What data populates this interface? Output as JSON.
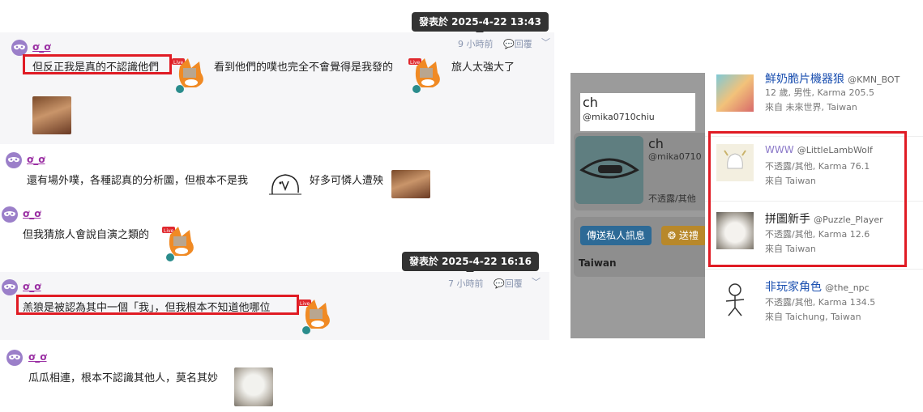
{
  "thread1": {
    "tooltip": "發表於 2025-4-22 13:43",
    "time": "9 小時前",
    "reply": "回覆",
    "username": "ơ_ơ",
    "segments": [
      "但反正我是真的不認識他們",
      "看到他們的噗也完全不會覺得是我發的",
      "旅人太強大了"
    ]
  },
  "msg2": {
    "username": "ơ_ơ",
    "segments": [
      "還有場外噗，各種認真的分析圖，但根本不是我",
      "好多可憐人遭殃"
    ]
  },
  "msg3": {
    "username": "ơ_ơ",
    "text": "但我猜旅人會說自演之類的"
  },
  "thread2": {
    "tooltip": "發表於 2025-4-22 16:16",
    "time": "7 小時前",
    "reply": "回覆",
    "username": "ơ_ơ",
    "text": "羔狼是被認為其中一個「我」，但我根本不知道他哪位"
  },
  "msg5": {
    "username": "ơ_ơ",
    "text": "瓜瓜相連，根本不認識其他人，莫名其妙"
  },
  "live_badge": "Live",
  "profile": {
    "name": "ch",
    "handle": "@mika0710chiu",
    "card_name": "ch",
    "card_handle": "@mika0710",
    "card_gender": "不透露/其他",
    "pm_button": "傳送私人訊息",
    "gift_button": "送禮",
    "location": "Taiwan"
  },
  "users": [
    {
      "name": "鮮奶脆片機器狼",
      "handle": "@KMN_BOT",
      "info": "12 歲, 男性, Karma 205.5",
      "from": "來自 未來世界, Taiwan",
      "name_color": "#1a4fb0"
    },
    {
      "name": "WWW",
      "handle": "@LittleLambWolf",
      "info": "不透露/其他, Karma 76.1",
      "from": "來自 Taiwan",
      "name_color": "#8a78c8"
    },
    {
      "name": "拼圖新手",
      "handle": "@Puzzle_Player",
      "info": "不透露/其他, Karma 12.6",
      "from": "來自 Taiwan",
      "name_color": "#222222"
    },
    {
      "name": "非玩家角色",
      "handle": "@the_npc",
      "info": "不透露/其他, Karma 134.5",
      "from": "來自 Taichung, Taiwan",
      "name_color": "#1a4fb0"
    }
  ]
}
